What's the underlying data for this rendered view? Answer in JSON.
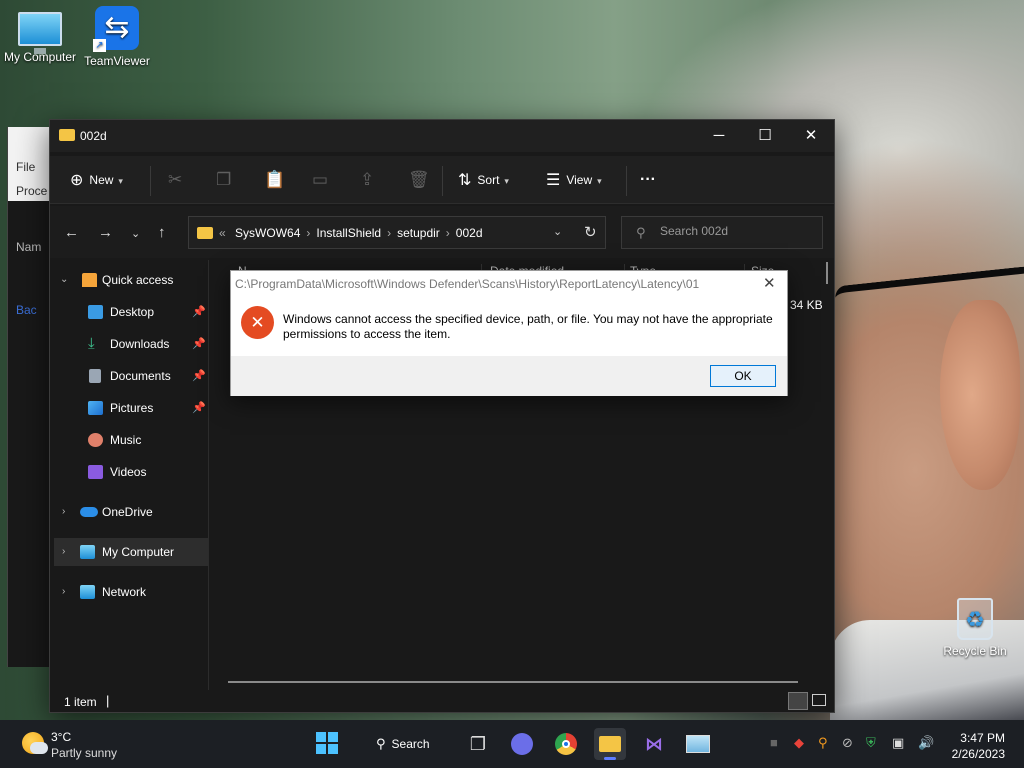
{
  "desktop": {
    "icons": [
      {
        "label": "My Computer",
        "icon": "monitor-icon"
      },
      {
        "label": "TeamViewer",
        "icon": "teamviewer-icon"
      },
      {
        "label": "Recycle Bin",
        "icon": "recycle-bin-icon"
      }
    ],
    "behind_window": {
      "file_menu": "File",
      "tab": "Proce",
      "col": "Nam",
      "side": "Bac"
    }
  },
  "explorer": {
    "title": "002d",
    "window_buttons": {
      "minimize": "─",
      "maximize": "☐",
      "close": "✕"
    },
    "toolbar": {
      "new_label": "New",
      "sort_label": "Sort",
      "view_label": "View",
      "more_label": "···"
    },
    "address": {
      "prefix": "«",
      "crumbs": [
        "SysWOW64",
        "InstallShield",
        "setupdir",
        "002d"
      ]
    },
    "search": {
      "placeholder": "Search 002d"
    },
    "nav": {
      "quick_access": "Quick access",
      "pinned": [
        "Desktop",
        "Downloads",
        "Documents",
        "Pictures"
      ],
      "unpinned": [
        "Music",
        "Videos"
      ],
      "onedrive": "OneDrive",
      "my_computer": "My Computer",
      "network": "Network"
    },
    "content": {
      "column_headers": [
        "N",
        "Date modified",
        "Type",
        "Size"
      ],
      "visible_size": "34 KB"
    },
    "status": {
      "item_count": "1 item"
    }
  },
  "dialog": {
    "title": "C:\\ProgramData\\Microsoft\\Windows Defender\\Scans\\History\\ReportLatency\\Latency\\01",
    "message": "Windows cannot access the specified device, path, or file. You may not have the appropriate permissions to access the item.",
    "ok_label": "OK",
    "close_glyph": "✕"
  },
  "taskbar": {
    "weather": {
      "temp": "3°C",
      "condition": "Partly sunny"
    },
    "search_label": "Search",
    "clock": {
      "time": "3:47 PM",
      "date": "2/26/2023"
    }
  }
}
